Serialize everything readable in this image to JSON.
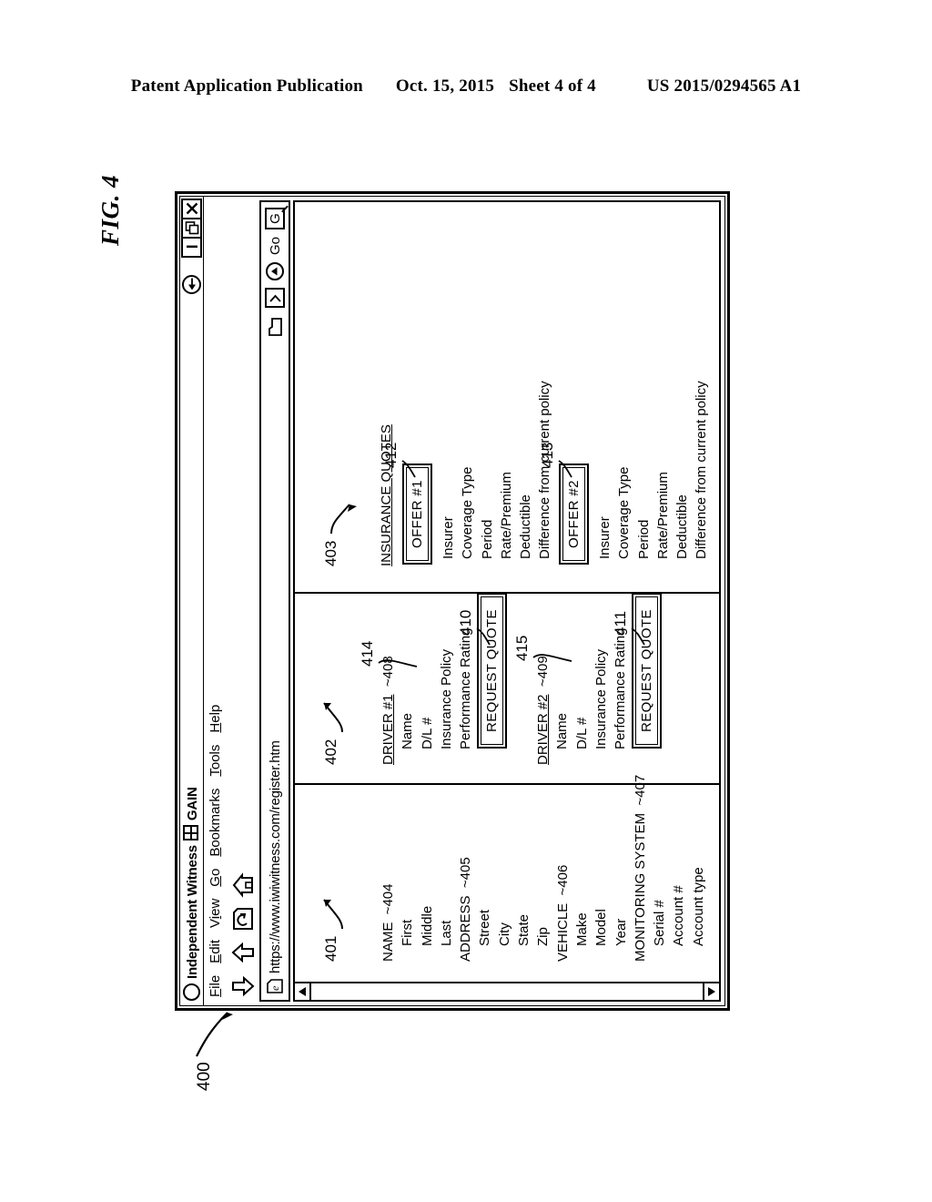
{
  "publication_header": {
    "left": "Patent Application Publication",
    "date": "Oct. 15, 2015",
    "sheet": "Sheet 4 of 4",
    "number": "US 2015/0294565 A1"
  },
  "figure": {
    "label": "FIG. 4",
    "root_ref": "400"
  },
  "browser": {
    "title": "Independent Witness",
    "title_suffix": "GAIN",
    "menu": [
      {
        "label": "File",
        "accesskey": "F"
      },
      {
        "label": "Edit",
        "accesskey": "E"
      },
      {
        "label": "View",
        "accesskey": "V"
      },
      {
        "label": "Go",
        "accesskey": "G"
      },
      {
        "label": "Bookmarks",
        "accesskey": "B"
      },
      {
        "label": "Tools",
        "accesskey": "T"
      },
      {
        "label": "Help",
        "accesskey": "H"
      }
    ],
    "toolbar_icons": [
      "back-arrow-icon",
      "forward-arrow-icon",
      "reload-icon",
      "home-icon"
    ],
    "window_buttons": [
      "minimize-icon",
      "restore-icon",
      "close-icon"
    ],
    "url": "https://www.iwiwitness.com/register.htm",
    "url_controls": {
      "folder_icon": "folder-icon",
      "dropdown_label": "›",
      "go_button": "Go",
      "search_label": "G"
    }
  },
  "page_content": {
    "panel_registration": {
      "ref": "401",
      "groups": [
        {
          "title": "NAME",
          "ref": "404",
          "fields": [
            "First",
            "Middle",
            "Last"
          ]
        },
        {
          "title": "ADDRESS",
          "ref": "405",
          "fields": [
            "Street",
            "City",
            "State",
            "Zip"
          ]
        },
        {
          "title": "VEHICLE",
          "ref": "406",
          "fields": [
            "Make",
            "Model",
            "Year"
          ]
        },
        {
          "title": "MONITORING SYSTEM",
          "ref": "407",
          "fields": [
            "Serial #",
            "Account #",
            "Account type"
          ]
        }
      ]
    },
    "panel_drivers": {
      "ref": "402",
      "drivers": [
        {
          "title": "DRIVER #1",
          "ref": "408",
          "fields": [
            "Name",
            "D/L #",
            "Insurance Policy",
            "Performance Rating"
          ],
          "rating_ref": "414",
          "button_label": "REQUEST QUOTE",
          "button_ref": "410"
        },
        {
          "title": "DRIVER #2",
          "ref": "409",
          "fields": [
            "Name",
            "D/L #",
            "Insurance Policy",
            "Performance Rating"
          ],
          "rating_ref": "415",
          "button_label": "REQUEST QUOTE",
          "button_ref": "411"
        }
      ]
    },
    "panel_quotes": {
      "ref": "403",
      "heading": "INSURANCE QUOTES",
      "offers": [
        {
          "button_label": "OFFER #1",
          "ref": "412",
          "fields": [
            "Insurer",
            "Coverage Type",
            "Period",
            "Rate/Premium",
            "Deductible",
            "Difference from current policy"
          ]
        },
        {
          "button_label": "OFFER #2",
          "ref": "413",
          "fields": [
            "Insurer",
            "Coverage Type",
            "Period",
            "Rate/Premium",
            "Deductible",
            "Difference from current policy"
          ]
        }
      ]
    }
  }
}
